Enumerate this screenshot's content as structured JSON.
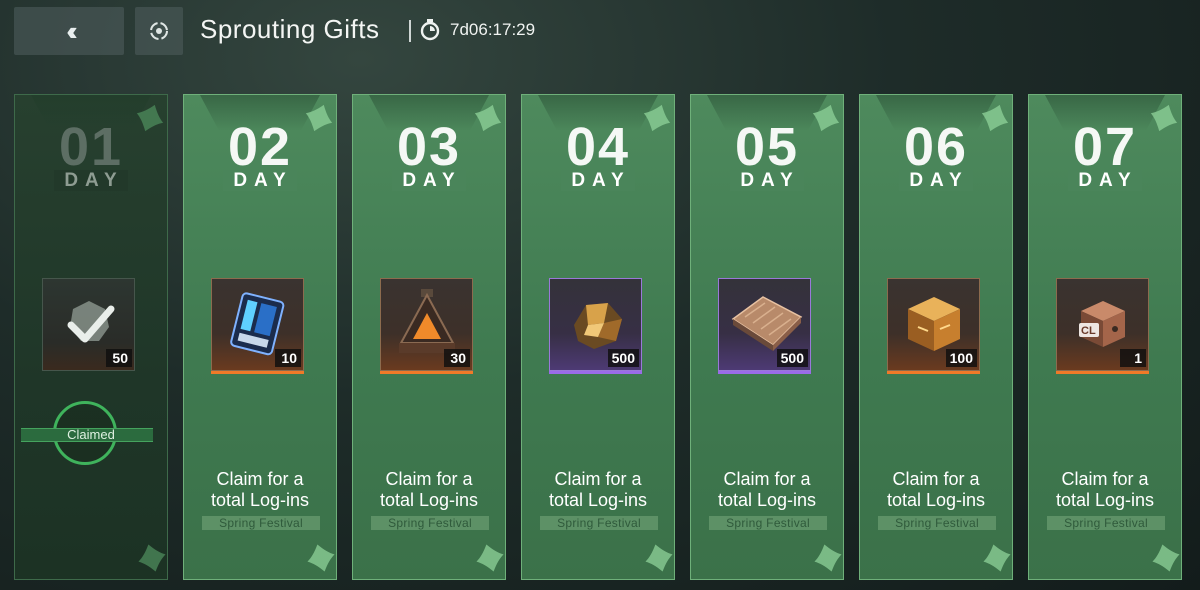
{
  "header": {
    "back_icon": "double-chevron-left-icon",
    "target_icon": "target-icon",
    "title": "Sprouting Gifts",
    "timer_icon": "stopwatch-icon",
    "timer": "7d06:17:29"
  },
  "day_label": "DAY",
  "claim_text_line1": "Claim for a",
  "claim_text_line2": "total Log-ins",
  "festival_label": "Spring Festival",
  "claimed_label": "Claimed",
  "days": [
    {
      "num": "01",
      "qty": "50",
      "item": "claimed-checkmark",
      "claimed": true
    },
    {
      "num": "02",
      "qty": "10",
      "item": "blue-chip",
      "rarity": "orange"
    },
    {
      "num": "03",
      "qty": "30",
      "item": "orange-pyramid",
      "rarity": "orange"
    },
    {
      "num": "04",
      "qty": "500",
      "item": "gold-ore",
      "rarity": "purple"
    },
    {
      "num": "05",
      "qty": "500",
      "item": "copper-plate",
      "rarity": "purple"
    },
    {
      "num": "06",
      "qty": "100",
      "item": "gold-cube",
      "rarity": "orange"
    },
    {
      "num": "07",
      "qty": "1",
      "item": "cl-cube",
      "rarity": "orange"
    }
  ],
  "colors": {
    "card_green": "#4e8a5d",
    "claimed_green": "#3fb35c",
    "rarity_orange": "#f07a28",
    "rarity_purple": "#9a6be8"
  }
}
